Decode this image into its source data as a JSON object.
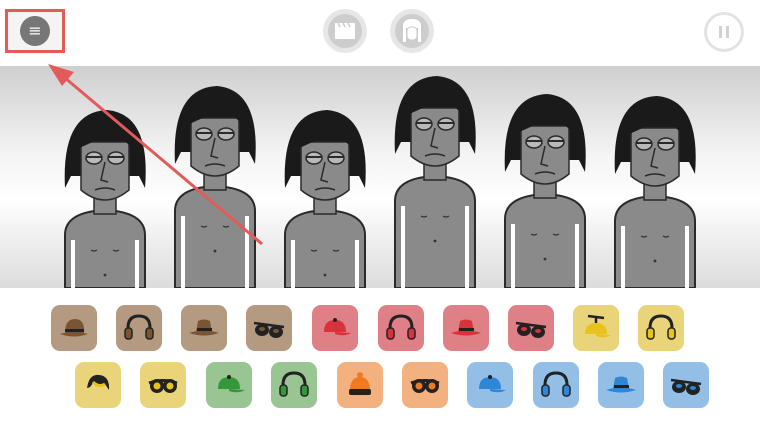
{
  "topbar": {
    "menu_glyph": "≡",
    "buttons": [
      {
        "name": "clapperboard-button",
        "icon": "clapperboard-icon"
      },
      {
        "name": "character-button",
        "icon": "character-face-icon"
      },
      {
        "name": "pause-button",
        "icon": "pause-icon"
      }
    ]
  },
  "characters": [
    {
      "name": "character-1",
      "state": "default"
    },
    {
      "name": "character-2",
      "state": "default"
    },
    {
      "name": "character-3",
      "state": "default"
    },
    {
      "name": "character-4",
      "state": "default"
    },
    {
      "name": "character-5",
      "state": "default"
    },
    {
      "name": "character-6",
      "state": "default"
    }
  ],
  "sound_icons": {
    "row1": [
      {
        "icon": "hat-icon",
        "color": "#b39a80"
      },
      {
        "icon": "headphones-icon",
        "color": "#b39a80"
      },
      {
        "icon": "fedora-icon",
        "color": "#b39a80"
      },
      {
        "icon": "sunglasses-icon",
        "color": "#b39a80"
      },
      {
        "icon": "cap-icon",
        "color": "#df7f86"
      },
      {
        "icon": "headphones-icon",
        "color": "#df7f86"
      },
      {
        "icon": "fedora-icon",
        "color": "#df7f86"
      },
      {
        "icon": "sunglasses-icon",
        "color": "#df7f86"
      },
      {
        "icon": "propeller-cap-icon",
        "color": "#ead47a"
      },
      {
        "icon": "headphones-icon",
        "color": "#ead47a"
      }
    ],
    "row2": [
      {
        "icon": "hair-icon",
        "color": "#ead47a"
      },
      {
        "icon": "goggles-icon",
        "color": "#ead47a"
      },
      {
        "icon": "cap-icon",
        "color": "#98c592"
      },
      {
        "icon": "headphones-icon",
        "color": "#98c592"
      },
      {
        "icon": "beanie-icon",
        "color": "#f2b17e"
      },
      {
        "icon": "goggles-icon",
        "color": "#f2b17e"
      },
      {
        "icon": "cap-icon",
        "color": "#93bfe7"
      },
      {
        "icon": "headphones-icon",
        "color": "#93bfe7"
      },
      {
        "icon": "fedora-icon",
        "color": "#93bfe7"
      },
      {
        "icon": "sunglasses-icon",
        "color": "#93bfe7"
      }
    ]
  },
  "colors": {
    "accent_annotation": "#e25a5a",
    "hat_fill_by_color": {
      "#b39a80": "#7a5535",
      "#df7f86": "#d8323c",
      "#ead47a": "#e8c21f",
      "#98c592": "#35973a",
      "#f2b17e": "#f07a22",
      "#93bfe7": "#2f86d6"
    }
  }
}
